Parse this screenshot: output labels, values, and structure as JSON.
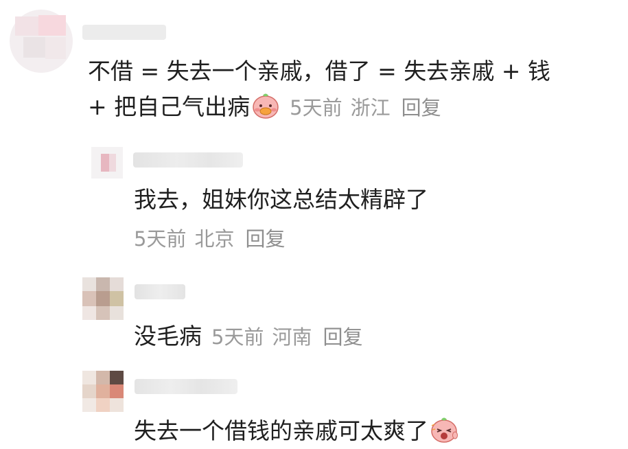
{
  "comments": [
    {
      "text_line1": "不借 = 失去一个亲戚，借了 = 失去亲戚 + 钱",
      "text_line2": "+ 把自己气出病",
      "emoji": "pig-emoji-happy",
      "time": "5天前",
      "location": "浙江",
      "reply": "回复"
    },
    {
      "text": "我去，姐妹你这总结太精辟了",
      "time": "5天前",
      "location": "北京",
      "reply": "回复"
    },
    {
      "text": "没毛病",
      "time": "5天前",
      "location": "河南",
      "reply": "回复"
    },
    {
      "text": "失去一个借钱的亲戚可太爽了",
      "emoji": "pig-emoji-excited"
    }
  ],
  "colors": {
    "text": "#1f1f1f",
    "meta": "#9a9a9a",
    "blur": "#e6e6e6"
  }
}
